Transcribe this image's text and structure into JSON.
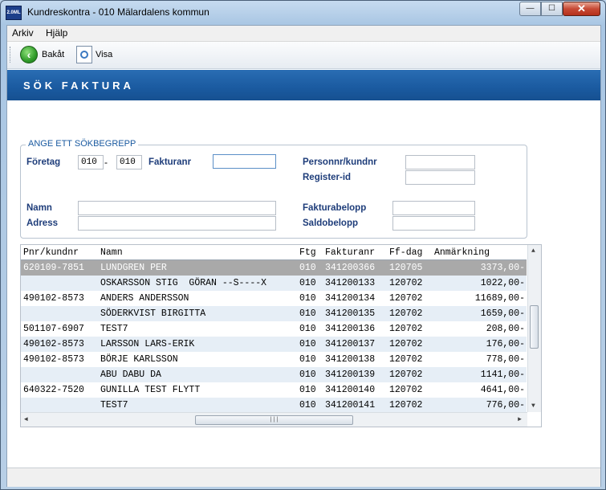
{
  "window": {
    "title": "Kundreskontra  -  010 Mälardalens kommun",
    "icon_text": "2.0ML",
    "min": "—",
    "max": "☐",
    "close": "✕"
  },
  "menu": {
    "items": [
      "Arkiv",
      "Hjälp"
    ]
  },
  "toolbar": {
    "back_label": "Bakåt",
    "view_label": "Visa",
    "back_icon": "arrow-left-icon",
    "view_icon": "magnifier-document-icon"
  },
  "banner": {
    "title": "SÖK FAKTURA"
  },
  "search": {
    "legend": "ANGE ETT SÖKBEGREPP",
    "company_label": "Företag",
    "company_from": "010",
    "company_dash": "-",
    "company_to": "010",
    "invoice_label": "Fakturanr",
    "invoice_value": "",
    "pnr_label": "Personnr/kundnr",
    "pnr_value": "",
    "register_label": "Register-id",
    "register_value": "",
    "name_label": "Namn",
    "name_value": "",
    "address_label": "Adress",
    "address_value": "",
    "amount_label": "Fakturabelopp",
    "amount_value": "",
    "balance_label": "Saldobelopp",
    "balance_value": ""
  },
  "table": {
    "columns": [
      "Pnr/kundnr",
      "Namn",
      "Ftg",
      "Fakturanr",
      "Ff-dag",
      "Anmärkning"
    ],
    "rows": [
      [
        "620109-7851",
        "LUNDGREN PER",
        "010",
        "341200366",
        "120705",
        "3373,00-"
      ],
      [
        "",
        "OSKARSSON STIG  GÖRAN --S----X",
        "010",
        "341200133",
        "120702",
        "1022,00-"
      ],
      [
        "490102-8573",
        "ANDERS ANDERSSON",
        "010",
        "341200134",
        "120702",
        "11689,00-"
      ],
      [
        "",
        "SÖDERKVIST BIRGITTA",
        "010",
        "341200135",
        "120702",
        "1659,00-"
      ],
      [
        "501107-6907",
        "TEST7",
        "010",
        "341200136",
        "120702",
        "208,00-"
      ],
      [
        "490102-8573",
        "LARSSON LARS-ERIK",
        "010",
        "341200137",
        "120702",
        "176,00-"
      ],
      [
        "490102-8573",
        "BÖRJE KARLSSON",
        "010",
        "341200138",
        "120702",
        "778,00-"
      ],
      [
        "",
        "ABU DABU DA",
        "010",
        "341200139",
        "120702",
        "1141,00-"
      ],
      [
        "640322-7520",
        "GUNILLA TEST FLYTT",
        "010",
        "341200140",
        "120702",
        "4641,00-"
      ],
      [
        "",
        "TEST7",
        "010",
        "341200141",
        "120702",
        "776,00-"
      ]
    ],
    "selected_row": 0
  },
  "scroll": {
    "up": "▲",
    "down": "▼",
    "left": "◄",
    "right": "►",
    "grip": "|||"
  },
  "colors": {
    "banner": "#1a5aa0",
    "label": "#1e3d7a",
    "selected_row": "#a9a9a9",
    "alt_row": "#e6eef6"
  }
}
